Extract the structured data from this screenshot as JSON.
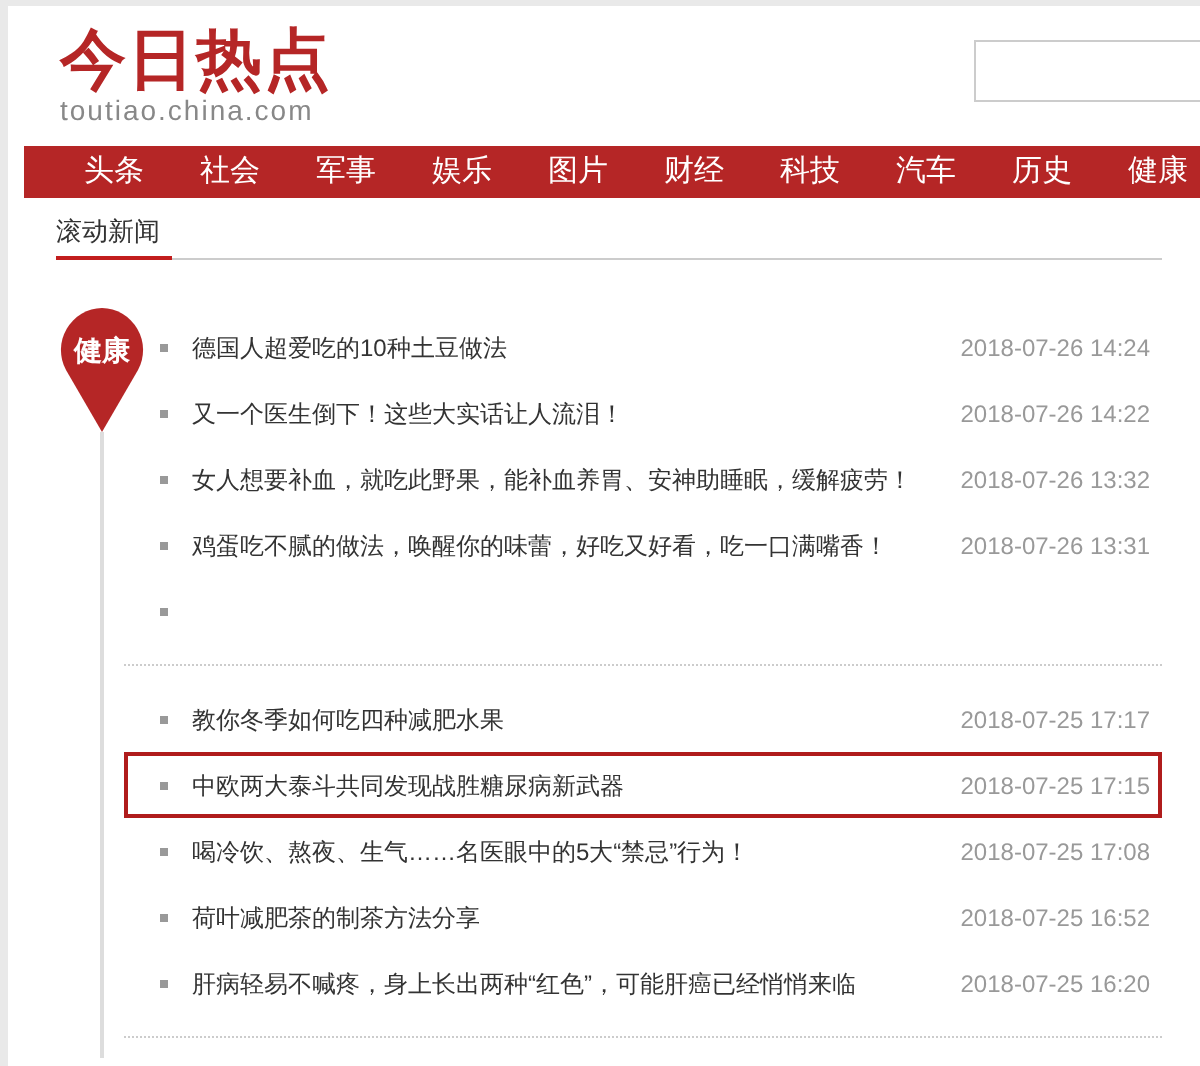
{
  "header": {
    "logo": "今日热点",
    "domain": "toutiao.china.com"
  },
  "nav": [
    "头条",
    "社会",
    "军事",
    "娱乐",
    "图片",
    "财经",
    "科技",
    "汽车",
    "历史",
    "健康"
  ],
  "section_tab": "滚动新闻",
  "timeline": {
    "category": "健康",
    "groups": [
      {
        "rows": [
          {
            "kind": "news",
            "title": "德国人超爱吃的10种土豆做法",
            "time": "2018-07-26 14:24",
            "highlighted": false
          },
          {
            "kind": "news",
            "title": "又一个医生倒下！这些大实话让人流泪！",
            "time": "2018-07-26 14:22",
            "highlighted": false
          },
          {
            "kind": "news",
            "title": "女人想要补血，就吃此野果，能补血养胃、安神助睡眠，缓解疲劳！",
            "time": "2018-07-26 13:32",
            "highlighted": false
          },
          {
            "kind": "news",
            "title": "鸡蛋吃不腻的做法，唤醒你的味蕾，好吃又好看，吃一口满嘴香！",
            "time": "2018-07-26 13:31",
            "highlighted": false
          },
          {
            "kind": "blank",
            "highlighted": false
          }
        ]
      },
      {
        "rows": [
          {
            "kind": "news",
            "title": "教你冬季如何吃四种减肥水果",
            "time": "2018-07-25 17:17",
            "highlighted": false
          },
          {
            "kind": "news",
            "title": "中欧两大泰斗共同发现战胜糖尿病新武器",
            "time": "2018-07-25 17:15",
            "highlighted": true
          },
          {
            "kind": "news",
            "title": "喝冷饮、熬夜、生气……名医眼中的5大“禁忌”行为！",
            "time": "2018-07-25 17:08",
            "highlighted": false
          },
          {
            "kind": "news",
            "title": "荷叶减肥茶的制茶方法分享",
            "time": "2018-07-25 16:52",
            "highlighted": false
          },
          {
            "kind": "news",
            "title": "肝病轻易不喊疼，身上长出两种“红色”，可能肝癌已经悄悄来临",
            "time": "2018-07-25 16:20",
            "highlighted": false
          }
        ]
      }
    ]
  }
}
